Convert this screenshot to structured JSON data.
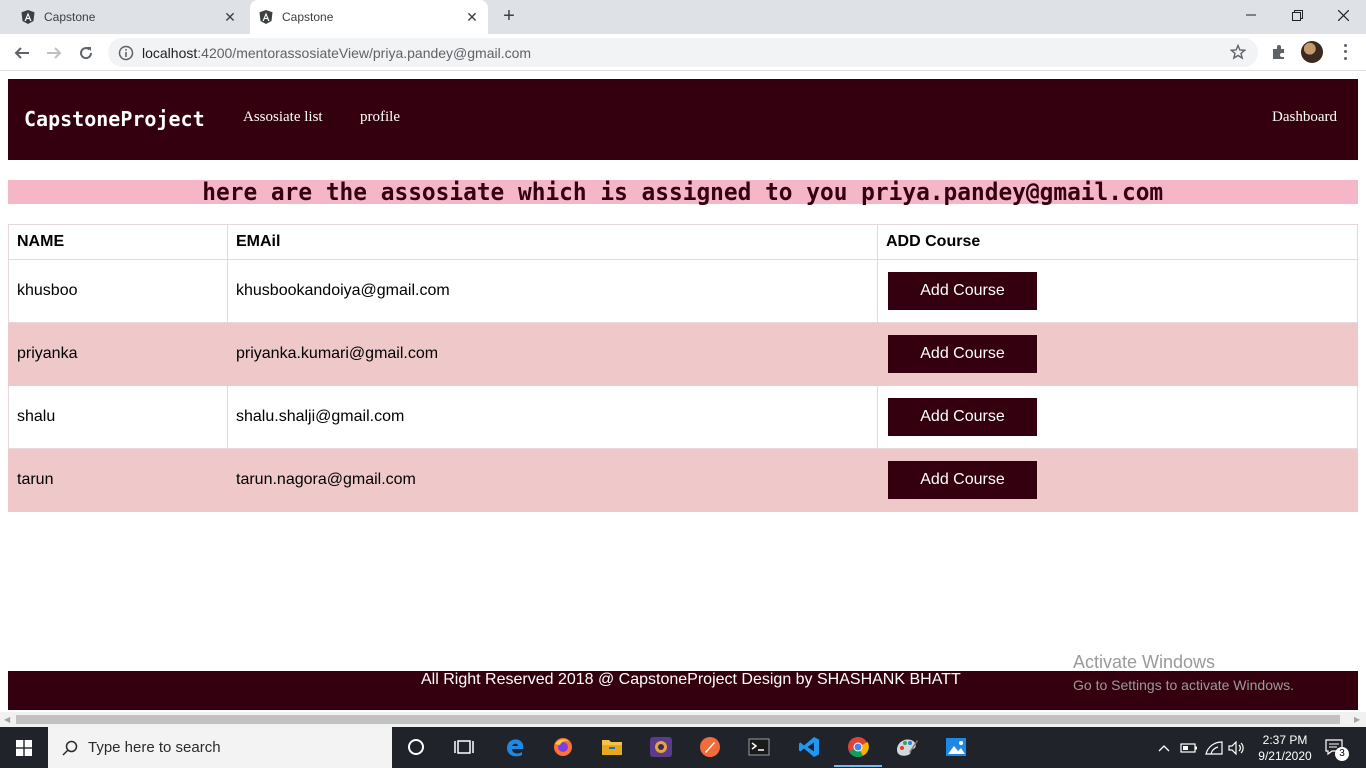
{
  "browser": {
    "tabs": [
      {
        "title": "Capstone",
        "active": false
      },
      {
        "title": "Capstone",
        "active": true
      }
    ],
    "url_host": "localhost",
    "url_path": ":4200/mentorassosiateView/priya.pandey@gmail.com"
  },
  "navbar": {
    "brand": "CapstoneProject",
    "links": [
      "Assosiate list",
      "profile"
    ],
    "right_link": "Dashboard"
  },
  "heading": "here are the assosiate which is assigned to you priya.pandey@gmail.com",
  "table": {
    "headers": [
      "NAME",
      "EMAil",
      "ADD Course"
    ],
    "rows": [
      {
        "name": "khusboo",
        "email": "khusbookandoiya@gmail.com",
        "action": "Add Course"
      },
      {
        "name": "priyanka",
        "email": "priyanka.kumari@gmail.com",
        "action": "Add Course"
      },
      {
        "name": "shalu",
        "email": "shalu.shalji@gmail.com",
        "action": "Add Course"
      },
      {
        "name": "tarun",
        "email": "tarun.nagora@gmail.com",
        "action": "Add Course"
      }
    ]
  },
  "footer": "All Right Reserved 2018 @ CapstoneProject Design by SHASHANK BHATT",
  "watermark": {
    "line1": "Activate Windows",
    "line2": "Go to Settings to activate Windows."
  },
  "taskbar": {
    "search_placeholder": "Type here to search",
    "time": "2:37 PM",
    "date": "9/21/2020",
    "notification_count": "3"
  },
  "colors": {
    "brand_dark": "#340010",
    "heading_bg": "#f5b6c8",
    "row_alt": "#efc8c9"
  }
}
